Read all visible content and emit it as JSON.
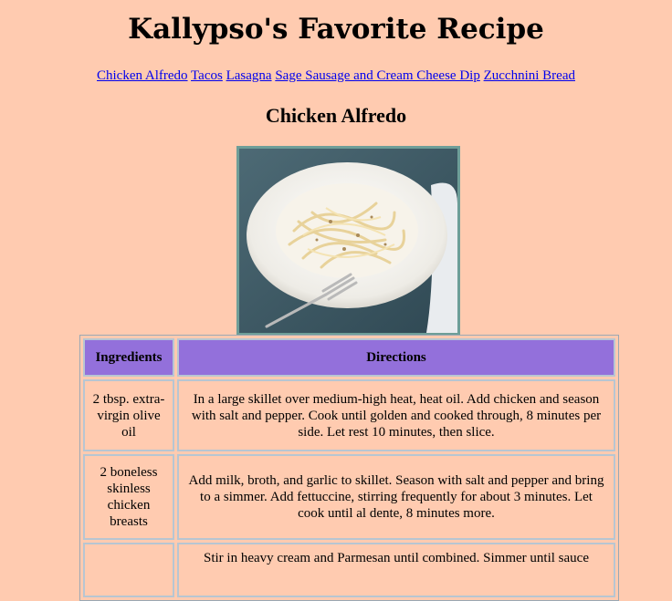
{
  "page": {
    "title": "Kallypso's Favorite Recipe",
    "subtitle": "Chicken Alfredo"
  },
  "nav": {
    "links": [
      "Chicken Alfredo",
      "Tacos",
      "Lasagna",
      "Sage Sausage and Cream Cheese Dip",
      "Zucchnini Bread"
    ]
  },
  "image": {
    "alt": "pasta-plate-photo"
  },
  "table": {
    "headers": [
      "Ingredients",
      "Directions"
    ],
    "rows": [
      {
        "ingredient": "2 tbsp. extra-virgin olive oil",
        "direction": "In a large skillet over medium-high heat, heat oil. Add chicken and season with salt and pepper. Cook until golden and cooked through, 8 minutes per side. Let rest 10 minutes, then slice."
      },
      {
        "ingredient": "2 boneless skinless chicken breasts",
        "direction": "Add milk, broth, and garlic to skillet. Season with salt and pepper and bring to a simmer. Add fettuccine, stirring frequently for about 3 minutes. Let cook until al dente, 8 minutes more."
      },
      {
        "ingredient": "",
        "direction": "Stir in heavy cream and Parmesan until combined. Simmer until sauce"
      }
    ]
  },
  "colors": {
    "background": "#ffcbb0",
    "header_cell": "#9370db",
    "link": "#0000ee",
    "image_border": "#6e9e98"
  }
}
